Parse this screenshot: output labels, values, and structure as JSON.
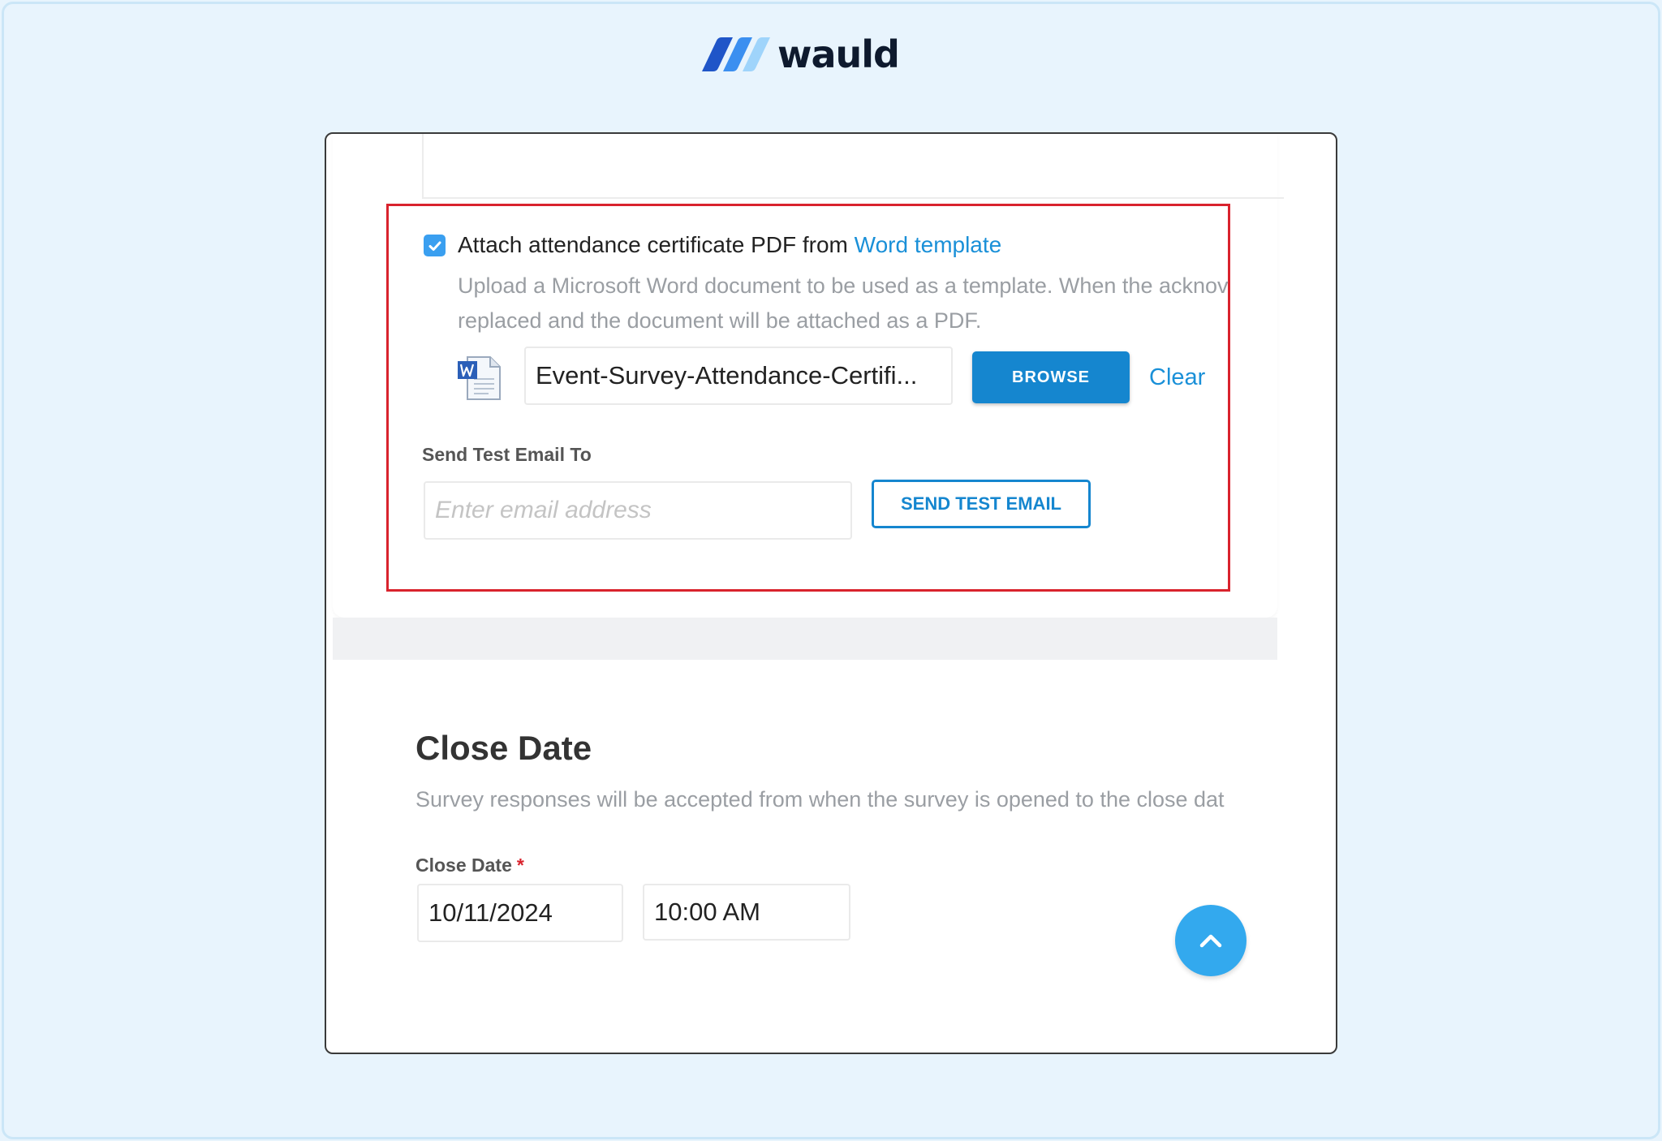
{
  "logo": {
    "text": "wauld"
  },
  "certificate": {
    "checkbox_checked": true,
    "label_prefix": "Attach attendance certificate PDF from ",
    "label_link": "Word template",
    "help_line1": "Upload a Microsoft Word document to be used as a template. When the acknov",
    "help_line2": "replaced and the document will be attached as a PDF.",
    "file_name": "Event-Survey-Attendance-Certifi...",
    "browse_label": "BROWSE",
    "clear_label": "Clear",
    "file_icon": "word-document-icon"
  },
  "test_email": {
    "label": "Send Test Email To",
    "placeholder": "Enter email address",
    "button_label": "SEND TEST EMAIL"
  },
  "close_date": {
    "title": "Close Date",
    "description": "Survey responses will be accepted from when the survey is opened to the close dat",
    "field_label": "Close Date",
    "required_mark": "*",
    "date_value": "10/11/2024",
    "time_value": "10:00 AM"
  },
  "scroll_top": {
    "icon": "chevron-up-icon"
  },
  "colors": {
    "accent": "#1586cf",
    "link": "#1a90d8",
    "highlight_border": "#d9232d",
    "page_background": "#e8f4fd"
  }
}
